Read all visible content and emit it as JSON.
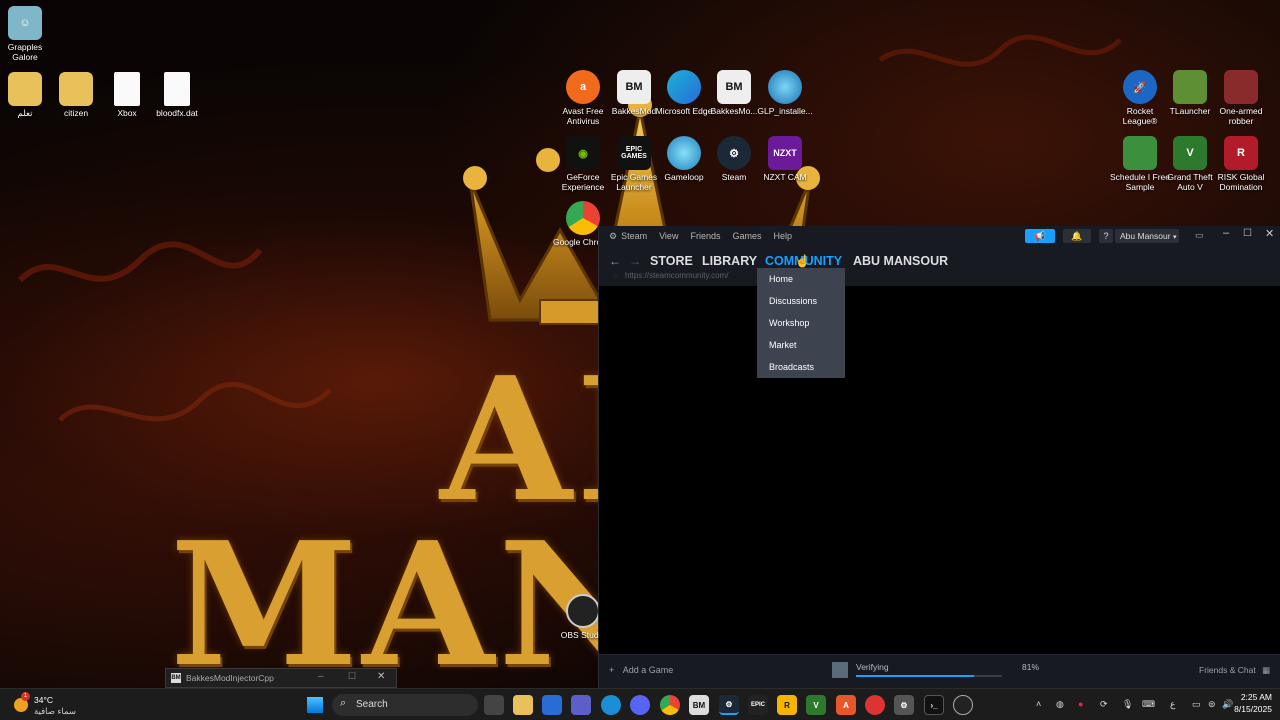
{
  "desktop": {
    "wallpaper_text": [
      "AI",
      "MAN"
    ],
    "icons_left": [
      {
        "label": "Grapples Galore",
        "icon": "game-icon"
      },
      {
        "label": "تعلم",
        "icon": "folder-icon"
      },
      {
        "label": "citizen",
        "icon": "folder-icon"
      },
      {
        "label": "Xbox",
        "icon": "file-icon"
      },
      {
        "label": "bloodfx.dat",
        "icon": "file-icon"
      }
    ],
    "icons_center_row1": [
      {
        "label": "Avast Free Antivirus",
        "icon": "avast-icon"
      },
      {
        "label": "BakkesMod",
        "icon": "bakkesmod-icon"
      },
      {
        "label": "Microsoft Edge",
        "icon": "edge-icon"
      },
      {
        "label": "BakkesMo...",
        "icon": "bakkesmod-icon"
      },
      {
        "label": "GLP_installe...",
        "icon": "installer-icon"
      }
    ],
    "icons_center_row2": [
      {
        "label": "GeForce Experience",
        "icon": "nvidia-icon"
      },
      {
        "label": "Epic Games Launcher",
        "icon": "epic-icon"
      },
      {
        "label": "Gameloop",
        "icon": "gameloop-icon"
      },
      {
        "label": "Steam",
        "icon": "steam-icon"
      },
      {
        "label": "NZXT CAM",
        "icon": "nzxt-icon"
      }
    ],
    "icons_center_row3": [
      {
        "label": "Google Chrome",
        "icon": "chrome-icon"
      }
    ],
    "icons_right_row1": [
      {
        "label": "Rocket League®",
        "icon": "rocket-league-icon"
      },
      {
        "label": "TLauncher",
        "icon": "tlauncher-icon"
      },
      {
        "label": "One-armed robber",
        "icon": "game-icon"
      }
    ],
    "icons_right_row2": [
      {
        "label": "Schedule I Free Sample",
        "icon": "game-icon"
      },
      {
        "label": "Grand Theft Auto V",
        "icon": "gta-icon"
      },
      {
        "label": "RISK Global Domination",
        "icon": "risk-icon"
      }
    ],
    "obs_icon": {
      "label": "OBS Studio",
      "icon": "obs-icon"
    },
    "nzxt_text": "NZXT",
    "epic_text": "EPIC GAMES"
  },
  "steam": {
    "menu": [
      "Steam",
      "View",
      "Friends",
      "Games",
      "Help"
    ],
    "account_name": "Abu Mansour",
    "help_glyph": "?",
    "nav": {
      "store": "STORE",
      "library": "LIBRARY",
      "community": "COMMUNITY",
      "profile": "ABU MANSOUR"
    },
    "url": "https://steamcommunity.com/",
    "community_dropdown": [
      "Home",
      "Discussions",
      "Workshop",
      "Market",
      "Broadcasts"
    ],
    "bottom": {
      "add_game": "Add a Game",
      "download_status": "Verifying",
      "download_percent": "81%",
      "download_progress": 0.81,
      "friends_chat": "Friends & Chat"
    },
    "accent": "#1a9fff",
    "announce_color": "#1a9fff"
  },
  "bakkes_window": {
    "title": "BakkesModInjectorCpp"
  },
  "taskbar": {
    "weather_temp": "34°C",
    "weather_desc": "سماء صافية",
    "weather_badge": "1",
    "search_label": "Search",
    "language": "ع",
    "time": "2:25 AM",
    "date": "8/15/2025"
  }
}
